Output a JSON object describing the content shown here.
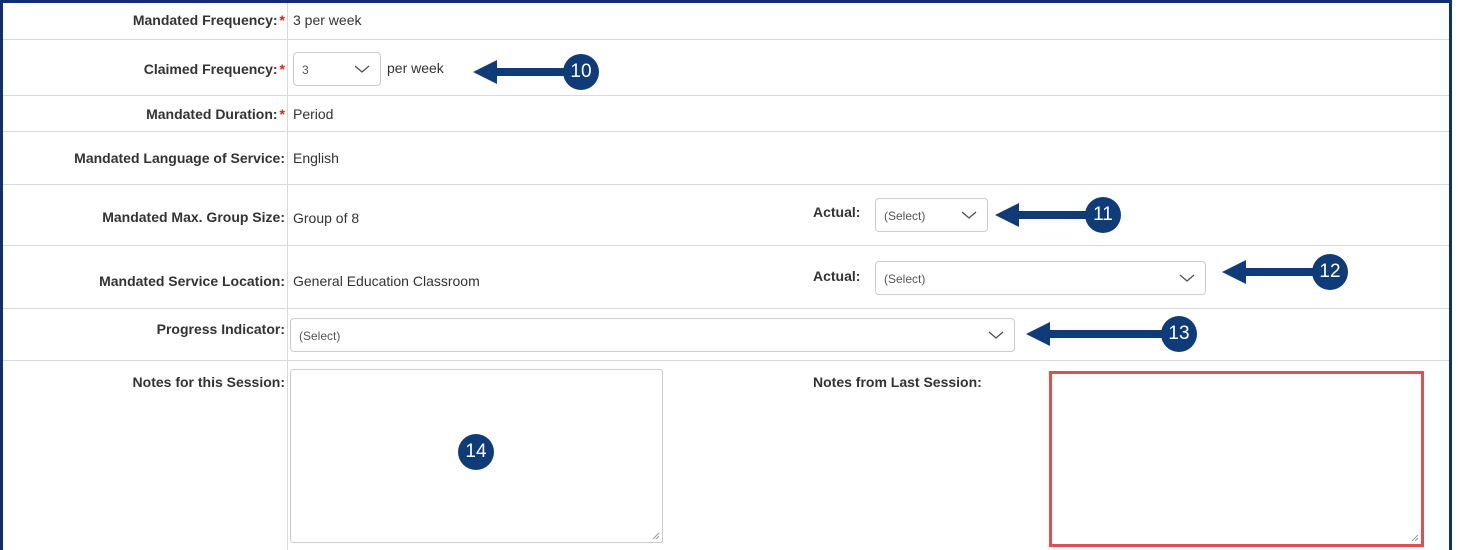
{
  "form": {
    "mandated_frequency": {
      "label": "Mandated Frequency:",
      "required": "*",
      "value": "3 per week"
    },
    "claimed_frequency": {
      "label": "Claimed Frequency:",
      "required": "*",
      "selected": "3",
      "suffix": "per week"
    },
    "mandated_duration": {
      "label": "Mandated Duration:",
      "required": "*",
      "value": "Period"
    },
    "mandated_language": {
      "label": "Mandated Language of Service:",
      "value": "English"
    },
    "mandated_group_size": {
      "label": "Mandated Max. Group Size:",
      "value": "Group of 8",
      "actual_label": "Actual:",
      "actual_selected": "(Select)"
    },
    "mandated_location": {
      "label": "Mandated Service Location:",
      "value": "General Education Classroom",
      "actual_label": "Actual:",
      "actual_selected": "(Select)"
    },
    "progress_indicator": {
      "label": "Progress Indicator:",
      "selected": "(Select)"
    },
    "notes_this_session": {
      "label": "Notes for this Session:",
      "value": ""
    },
    "notes_last_session": {
      "label": "Notes from Last Session:",
      "value": ""
    }
  },
  "callouts": [
    "10",
    "11",
    "12",
    "13",
    "14"
  ],
  "colors": {
    "callout": "#0f3b78",
    "required": "#e0201b",
    "highlight_border": "#e05050",
    "frame": "#0f2e73"
  },
  "icons": {
    "dropdown": "chevron-down-icon",
    "callout_arrow": "left-arrow-icon",
    "resize": "resize-grip-icon"
  }
}
